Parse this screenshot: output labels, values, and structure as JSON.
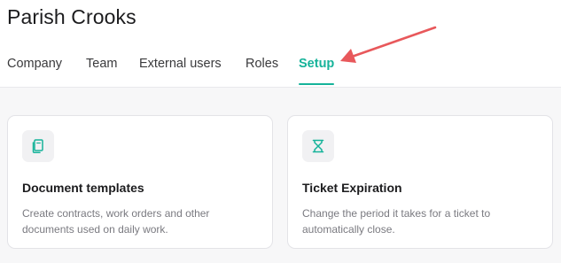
{
  "page": {
    "title": "Parish Crooks"
  },
  "tabs": [
    {
      "label": "Company",
      "active": false
    },
    {
      "label": "Team",
      "active": false
    },
    {
      "label": "External users",
      "active": false
    },
    {
      "label": "Roles",
      "active": false
    },
    {
      "label": "Setup",
      "active": true
    }
  ],
  "cards": [
    {
      "icon": "document-copy-icon",
      "title": "Document templates",
      "description": "Create contracts, work orders and other documents used on daily work."
    },
    {
      "icon": "hourglass-icon",
      "title": "Ticket Expiration",
      "description": "Change the period it takes for a ticket to automatically close."
    }
  ],
  "colors": {
    "accent": "#16b39a",
    "annotation_arrow": "#e8585b",
    "background": "#f7f7f8",
    "card_background": "#ffffff",
    "muted_text": "#7a7a80"
  }
}
